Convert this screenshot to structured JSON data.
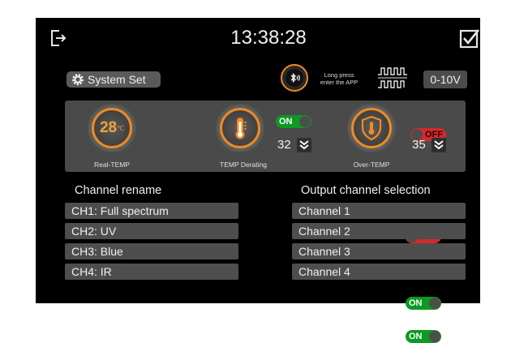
{
  "header": {
    "clock": "13:38:28",
    "exit_icon": "exit-icon",
    "confirm_icon": "checkbox-checked-icon"
  },
  "toolbar": {
    "system_set_label": "System Set",
    "bluetooth_icon": "bluetooth-icon",
    "long_press_line1": "Long press",
    "long_press_line2": "enter the APP",
    "waveform_icon": "pwm-waveform-icon",
    "output_mode": "0-10V"
  },
  "sensors": {
    "real_temp": {
      "value": "28",
      "unit": "℃",
      "label": "Real-TEMP"
    },
    "derating": {
      "label": "TEMP Derating",
      "toggle": "ON",
      "value": "32"
    },
    "over_temp": {
      "label": "Over-TEMP",
      "toggle": "OFF",
      "value": "35"
    }
  },
  "rename": {
    "title": "Channel rename",
    "channels": [
      "CH1: Full spectrum",
      "CH2: UV",
      "CH3: Blue",
      "CH4: IR"
    ]
  },
  "output": {
    "title": "Output channel selection",
    "channels": [
      {
        "label": "Channel 1",
        "state": "OFF"
      },
      {
        "label": "Channel 2",
        "state": "ON"
      },
      {
        "label": "Channel 3",
        "state": "ON"
      },
      {
        "label": "Channel 4",
        "state": "ON"
      }
    ]
  },
  "colors": {
    "accent": "#f08a24",
    "on": "#0c9a22",
    "off": "#d22a2a",
    "panel": "#4a4a4a"
  }
}
